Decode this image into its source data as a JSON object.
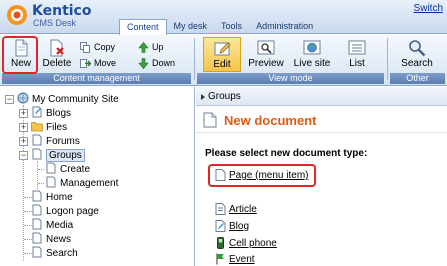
{
  "header": {
    "logo_title": "Kentico",
    "logo_subtitle": "CMS Desk",
    "switch_link": "Switch",
    "tabs": [
      {
        "label": "Content",
        "active": true
      },
      {
        "label": "My desk",
        "active": false
      },
      {
        "label": "Tools",
        "active": false
      },
      {
        "label": "Administration",
        "active": false
      }
    ]
  },
  "toolbar": {
    "content_management": {
      "caption": "Content management",
      "new_label": "New",
      "delete_label": "Delete",
      "copy_label": "Copy",
      "move_label": "Move",
      "up_label": "Up",
      "down_label": "Down"
    },
    "view_mode": {
      "caption": "View mode",
      "edit_label": "Edit",
      "preview_label": "Preview",
      "live_site_label": "Live site",
      "list_label": "List"
    },
    "other": {
      "caption": "Other",
      "search_label": "Search"
    }
  },
  "tree": {
    "root": "My Community Site",
    "items": {
      "blogs": "Blogs",
      "files": "Files",
      "forums": "Forums",
      "groups": "Groups",
      "create": "Create",
      "management": "Management",
      "home": "Home",
      "logon_page": "Logon page",
      "media": "Media",
      "news": "News",
      "search": "Search"
    }
  },
  "content": {
    "breadcrumb": "Groups",
    "title": "New document",
    "prompt": "Please select new document type:",
    "doc_types": {
      "page": "Page (menu item)",
      "article": "Article",
      "blog": "Blog",
      "cell_phone": "Cell phone",
      "event": "Event"
    }
  },
  "colors": {
    "accent_orange": "#e25b12",
    "highlight_red": "#e0262b",
    "brand_blue": "#1f4f9b"
  }
}
